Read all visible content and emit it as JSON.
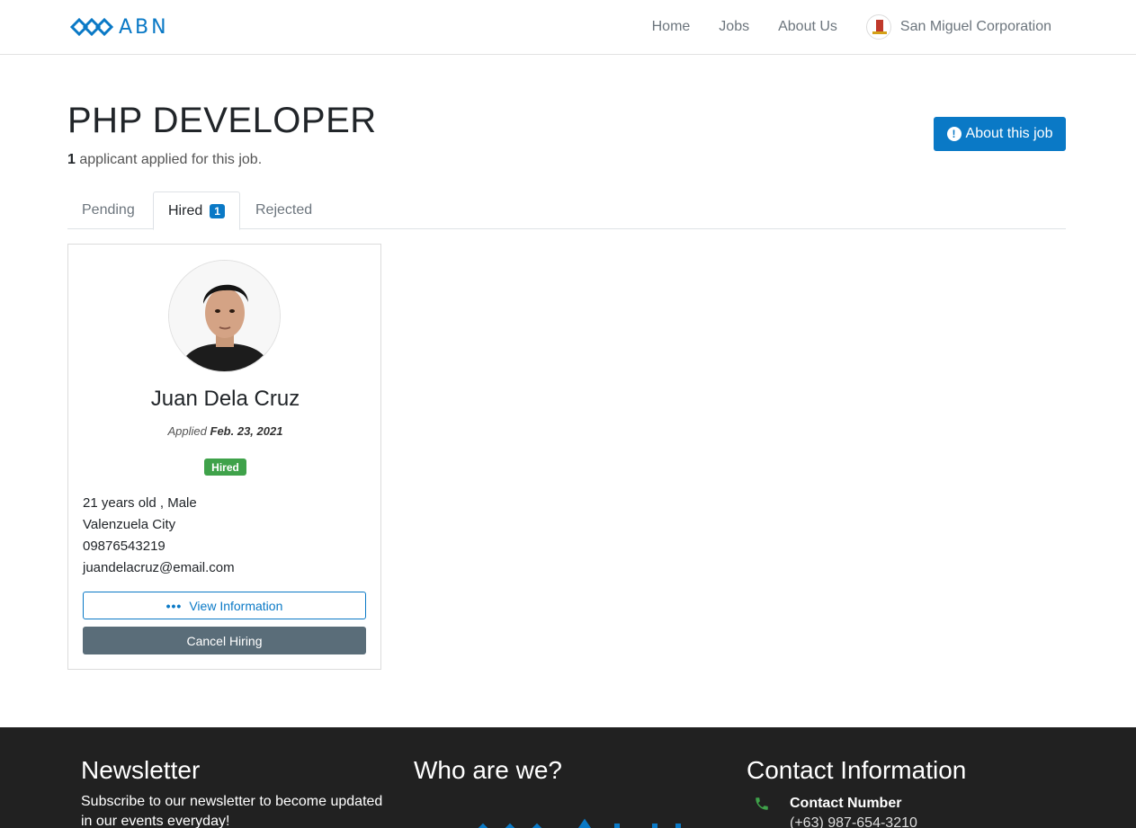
{
  "nav": {
    "brand": "ABN",
    "links": [
      "Home",
      "Jobs",
      "About Us"
    ],
    "company": "San Miguel Corporation"
  },
  "job": {
    "title": "PHP DEVELOPER",
    "applicant_count": "1",
    "applicant_text": " applicant applied for this job.",
    "about_button": "About this job"
  },
  "tabs": [
    {
      "label": "Pending"
    },
    {
      "label": "Hired",
      "count": "1"
    },
    {
      "label": "Rejected"
    }
  ],
  "applicant": {
    "name": "Juan Dela Cruz",
    "applied_label": "Applied",
    "applied_date": "Feb. 23, 2021",
    "status": "Hired",
    "age_sex": "21 years old , Male",
    "city": "Valenzuela City",
    "phone": "09876543219",
    "email": "juandelacruz@email.com",
    "view_button": "View Information",
    "cancel_button": "Cancel Hiring"
  },
  "footer": {
    "newsletter_title": "Newsletter",
    "newsletter_text": "Subscribe to our newsletter to become updated in our events everyday!",
    "who_title": "Who are we?",
    "contact_title": "Contact Information",
    "contact_label": "Contact Number",
    "contact_number": "(+63) 987-654-3210"
  },
  "colors": {
    "primary": "#0a79c6",
    "success": "#3fa24a",
    "secondary": "#5a6d79",
    "footer_bg": "#212121"
  },
  "icons": [
    "abn-logo-icon",
    "company-logo-icon",
    "exclamation-circle-icon",
    "ellipsis-icon",
    "phone-icon",
    "user-photo"
  ]
}
